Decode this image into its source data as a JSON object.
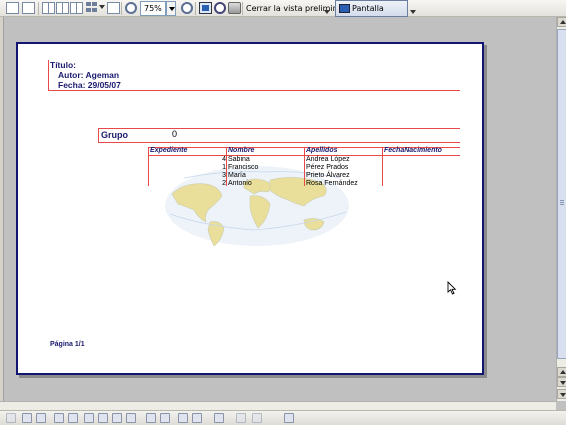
{
  "toolbar": {
    "zoom_value": "75%",
    "close_preview_label": "Cerrar la vista preliminar",
    "fullscreen_label": "Pantalla completa"
  },
  "report": {
    "title_label": "Título:",
    "author_line": "Autor: Ageman",
    "date_line": "Fecha: 29/05/07",
    "group_label": "Grupo",
    "group_value": "0",
    "columns": [
      "Expediente",
      "Nombre",
      "Apellidos",
      "FechaNacimiento"
    ],
    "rows": [
      {
        "expediente": "4",
        "nombre": "Sabina",
        "apellidos": "Andrea López"
      },
      {
        "expediente": "1",
        "nombre": "Francisco",
        "apellidos": "Pérez Prados"
      },
      {
        "expediente": "3",
        "nombre": "María",
        "apellidos": "Prieto Álvarez"
      },
      {
        "expediente": "2",
        "nombre": "Antonio",
        "apellidos": "Rosa Fernández"
      }
    ],
    "footer_page": "Página 1/1"
  },
  "colors": {
    "page_border": "#131572",
    "label_text": "#1a1a6e",
    "rule_line": "#e84a4a",
    "workspace": "#c0c0c0"
  },
  "icons": {
    "toolbar": [
      "page-icon",
      "page-icon",
      "two-pages-icon",
      "two-pages-icon",
      "multi-pages-icon",
      "multi-pages-icon",
      "grid-icon",
      "book-icon",
      "zoom-in-icon",
      "zoom-out-icon",
      "single-page-icon",
      "print-preview-icon",
      "print-icon",
      "fullscreen-icon"
    ],
    "watermark": "world-map-icon"
  }
}
